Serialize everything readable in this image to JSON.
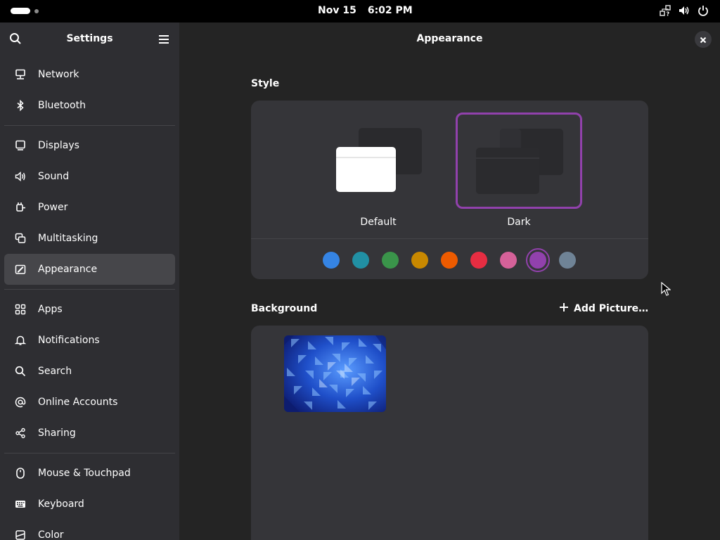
{
  "topbar": {
    "date": "Nov 15",
    "time": "6:02 PM",
    "icons": [
      "activities-indicator",
      "network-unknown-icon",
      "volume-icon",
      "power-icon"
    ]
  },
  "sidebar": {
    "title": "Settings",
    "items": [
      {
        "label": "Network",
        "icon": "network-icon"
      },
      {
        "label": "Bluetooth",
        "icon": "bluetooth-icon"
      },
      {
        "label": "Displays",
        "icon": "display-icon"
      },
      {
        "label": "Sound",
        "icon": "sound-icon"
      },
      {
        "label": "Power",
        "icon": "power-plug-icon"
      },
      {
        "label": "Multitasking",
        "icon": "multitasking-icon"
      },
      {
        "label": "Appearance",
        "icon": "appearance-icon",
        "active": true
      },
      {
        "label": "Apps",
        "icon": "apps-grid-icon"
      },
      {
        "label": "Notifications",
        "icon": "bell-icon"
      },
      {
        "label": "Search",
        "icon": "search-icon"
      },
      {
        "label": "Online Accounts",
        "icon": "at-icon"
      },
      {
        "label": "Sharing",
        "icon": "share-icon"
      },
      {
        "label": "Mouse & Touchpad",
        "icon": "mouse-icon"
      },
      {
        "label": "Keyboard",
        "icon": "keyboard-icon"
      },
      {
        "label": "Color",
        "icon": "color-icon"
      }
    ]
  },
  "main": {
    "title": "Appearance",
    "style_section": {
      "title": "Style",
      "options": [
        {
          "label": "Default",
          "selected": false
        },
        {
          "label": "Dark",
          "selected": true
        }
      ],
      "accent_colors": [
        "#3584e4",
        "#2190a4",
        "#3a944a",
        "#c88800",
        "#ed5b00",
        "#e62d42",
        "#d56199",
        "#9141ac",
        "#6f8396"
      ],
      "selected_accent": "#9141ac"
    },
    "background_section": {
      "title": "Background",
      "add_picture_label": "Add Picture…"
    }
  }
}
